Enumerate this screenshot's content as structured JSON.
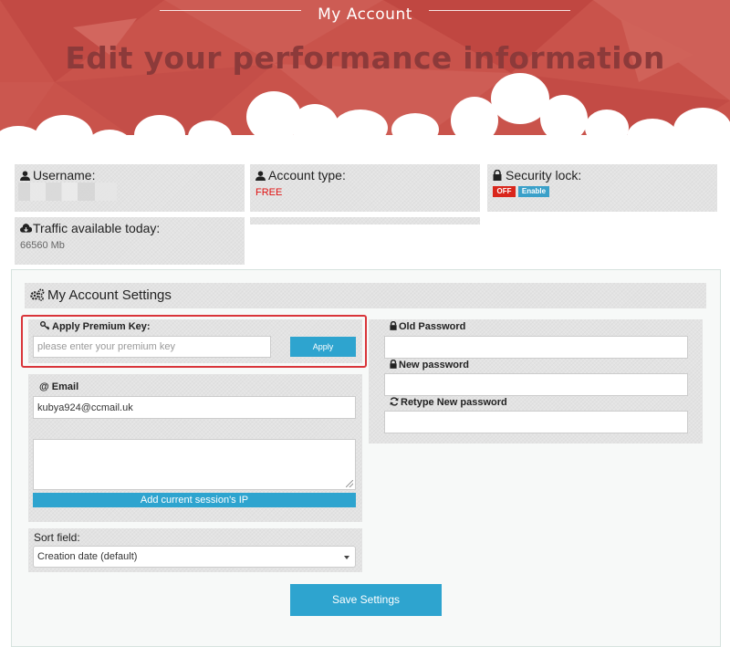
{
  "header": {
    "top_title": "My Account",
    "main_title": "Edit your performance information"
  },
  "info": {
    "username_label": "Username:",
    "account_type_label": "Account type:",
    "account_type_value": "FREE",
    "security_lock_label": "Security lock:",
    "security_off_badge": "OFF",
    "security_enable_button": "Enable",
    "traffic_label": "Traffic available today:",
    "traffic_value": "66560 Mb"
  },
  "settings": {
    "title": "My Account Settings",
    "premium_key_label": "Apply Premium Key:",
    "premium_key_placeholder": "please enter your premium key",
    "apply_button": "Apply",
    "email_label": "@ Email",
    "email_value": "kubya924@ccmail.uk",
    "add_ip_button": "Add current session's IP",
    "sort_label": "Sort field:",
    "sort_selected": "Creation date (default)",
    "old_password_label": "Old Password",
    "new_password_label": "New password",
    "retype_password_label": "Retype New password",
    "save_button": "Save Settings"
  },
  "colors": {
    "header_bg": "#c9534b",
    "title_color": "#8c3a3a",
    "accent_blue": "#2ea4cf",
    "free_red": "#e01010",
    "highlight_red": "#d9353a"
  },
  "icons": {
    "username": "user-icon",
    "account_type": "user-icon",
    "security_lock": "lock-icon",
    "traffic": "cloud-download-icon",
    "settings": "gears-icon",
    "premium_key": "key-icon",
    "old_password": "lock-icon",
    "new_password": "lock-icon",
    "retype_password": "refresh-icon"
  }
}
